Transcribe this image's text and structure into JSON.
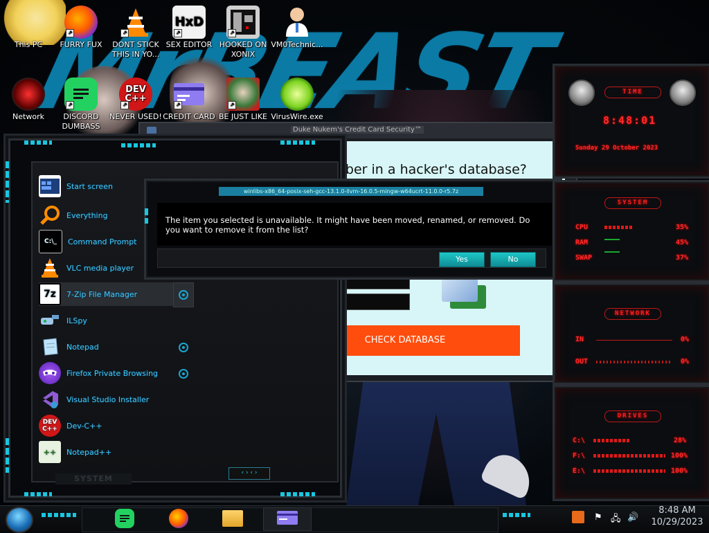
{
  "desktop": {
    "icons": [
      {
        "label": "This PC",
        "icon": "this-pc-icon"
      },
      {
        "label": "FURRY FUX",
        "icon": "firefox-icon"
      },
      {
        "label": "DONT STICK THIS IN YO...",
        "icon": "vlc-cone-icon"
      },
      {
        "label": "SEX EDITOR",
        "icon": "hxd-icon"
      },
      {
        "label": "HOOKED ON XONIX",
        "icon": "xonix-icon"
      },
      {
        "label": "VM0Technic...",
        "icon": "doctor-icon"
      },
      {
        "label": "Network",
        "icon": "network-icon"
      },
      {
        "label": "DISCORD DUMBASS",
        "icon": "discord-icon"
      },
      {
        "label": "NEVER USED!",
        "icon": "devcpp-icon"
      },
      {
        "label": "CREDIT CARD",
        "icon": "credit-card-icon"
      },
      {
        "label": "BE JUST LIKE",
        "icon": "elf-icon"
      },
      {
        "label": "VirusWire.exe",
        "icon": "lime-icon"
      }
    ]
  },
  "browser": {
    "title": "Duke Nukem's Credit Card Security™",
    "heading": "Is your credit card number in a hacker's database?",
    "check_button": "CHECK DATABASE"
  },
  "start_menu": {
    "items": [
      {
        "label": "Start screen",
        "icon": "start-screen-icon"
      },
      {
        "label": "Everything",
        "icon": "magnifier-icon"
      },
      {
        "label": "Command Prompt",
        "icon": "terminal-icon"
      },
      {
        "label": "VLC media player",
        "icon": "vlc-cone-icon"
      },
      {
        "label": "7-Zip File Manager",
        "icon": "7zip-icon"
      },
      {
        "label": "ILSpy",
        "icon": "ilspy-icon"
      },
      {
        "label": "Notepad",
        "icon": "notepad-icon"
      },
      {
        "label": "Firefox Private Browsing",
        "icon": "private-browsing-icon"
      },
      {
        "label": "Visual Studio Installer",
        "icon": "visual-studio-icon"
      },
      {
        "label": "Dev-C++",
        "icon": "devcpp-icon"
      },
      {
        "label": "Notepad++",
        "icon": "notepadpp-icon"
      }
    ],
    "footer": "SYSTEM"
  },
  "dialog": {
    "title": "winlibs-x86_64-posix-seh-gcc-13.1.0-llvm-16.0.5-mingw-w64ucrt-11.0.0-r5.7z",
    "message": "The item you selected is unavailable.  It might have been moved, renamed, or removed.  Do you want to remove it from the list?",
    "yes": "Yes",
    "no": "No"
  },
  "gadgets": {
    "time": {
      "title": "TIME",
      "time": "8:48:01",
      "date": "Sunday 29 October 2023"
    },
    "system": {
      "title": "SYSTEM",
      "cpu_label": "CPU",
      "cpu": "35%",
      "ram_label": "RAM",
      "ram": "45%",
      "swap_label": "SWAP",
      "swap": "37%"
    },
    "network": {
      "title": "NETWORK",
      "in_label": "IN",
      "in": "0%",
      "out_label": "OUT",
      "out": "0%"
    },
    "drives": {
      "title": "DRIVES",
      "c_label": "C:\\",
      "c": "28%",
      "f_label": "F:\\",
      "f": "100%",
      "e_label": "E:\\",
      "e": "100%"
    }
  },
  "taskbar": {
    "time": "8:48 AM",
    "date": "10/29/2023"
  },
  "colors": {
    "accent_cyan": "#19c6e0",
    "gadget_red": "#ff2020",
    "db_button": "#ff4d0d"
  }
}
